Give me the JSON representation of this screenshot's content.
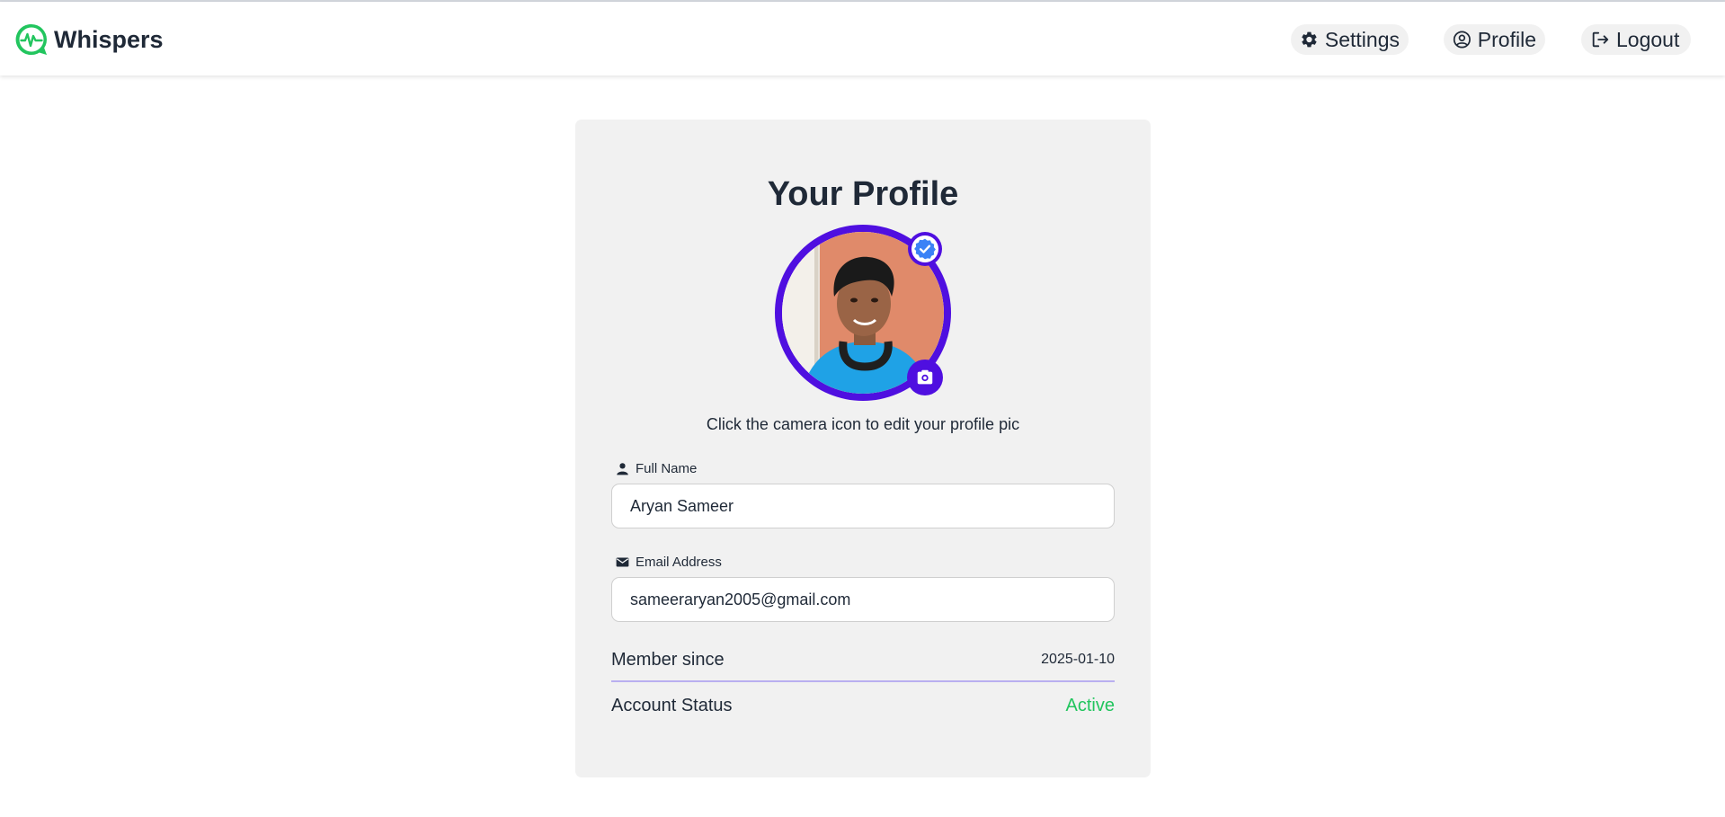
{
  "app": {
    "name": "Whispers",
    "logo_icon": "chat-pulse-logo-icon",
    "brand_color": "#22c55e"
  },
  "nav": [
    {
      "label": "Settings",
      "icon": "gear-icon"
    },
    {
      "label": "Profile",
      "icon": "user-circle-icon"
    },
    {
      "label": "Logout",
      "icon": "logout-icon"
    }
  ],
  "profile": {
    "title": "Your Profile",
    "hint": "Click the camera icon to edit your profile pic",
    "avatar_ring_color": "#4f0fe0",
    "verified_badge_icon": "verified-check-icon",
    "camera_icon": "camera-icon",
    "fields": {
      "name": {
        "label": "Full Name",
        "icon": "user-icon",
        "value": "Aryan Sameer"
      },
      "email": {
        "label": "Email Address",
        "icon": "mail-icon",
        "value": "sameeraryan2005@gmail.com"
      }
    },
    "member_since": {
      "label": "Member since",
      "value": "2025-01-10"
    },
    "account_status": {
      "label": "Account Status",
      "value": "Active",
      "color": "#22c55e"
    }
  }
}
